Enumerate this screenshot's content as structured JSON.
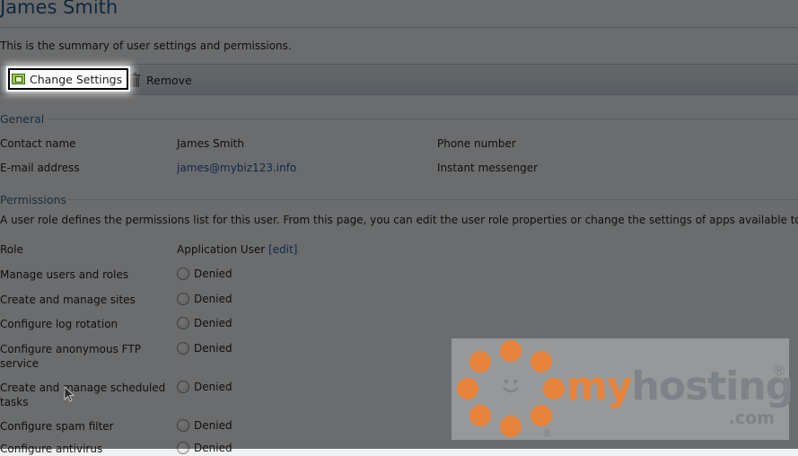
{
  "page": {
    "title": "James Smith",
    "summary": "This is the summary of user settings and permissions."
  },
  "toolbar": {
    "change_settings_label": "Change Settings",
    "remove_label": "Remove"
  },
  "general": {
    "heading": "General",
    "contact_name_label": "Contact name",
    "contact_name_value": "James Smith",
    "phone_label": "Phone number",
    "email_label": "E-mail address",
    "email_value": "james@mybiz123.info",
    "im_label": "Instant messenger"
  },
  "permissions": {
    "heading": "Permissions",
    "note": "A user role defines the permissions list for this user. From this page, you can edit the user role properties or change the settings of apps available to th",
    "role_label": "Role",
    "role_value": "Application User",
    "edit_link": "[edit]",
    "items": [
      {
        "label": "Manage users and roles",
        "value": "Denied"
      },
      {
        "label": "Create and manage sites",
        "value": "Denied"
      },
      {
        "label": "Configure log rotation",
        "value": "Denied"
      },
      {
        "label": "Configure anonymous FTP service",
        "value": "Denied"
      },
      {
        "label": "Create and manage scheduled tasks",
        "value": "Denied"
      },
      {
        "label": "Configure spam filter",
        "value": "Denied"
      },
      {
        "label": "Configure antivirus",
        "value": "Denied"
      }
    ]
  },
  "watermark": {
    "brand_my": "my",
    "brand_hosting": "hosting",
    "brand_com": ".com",
    "reg_mark": "®"
  },
  "colors": {
    "title": "#1e5a8c",
    "link": "#2159a8",
    "brand_orange": "#e6823a",
    "brand_gray": "#7d8388"
  }
}
